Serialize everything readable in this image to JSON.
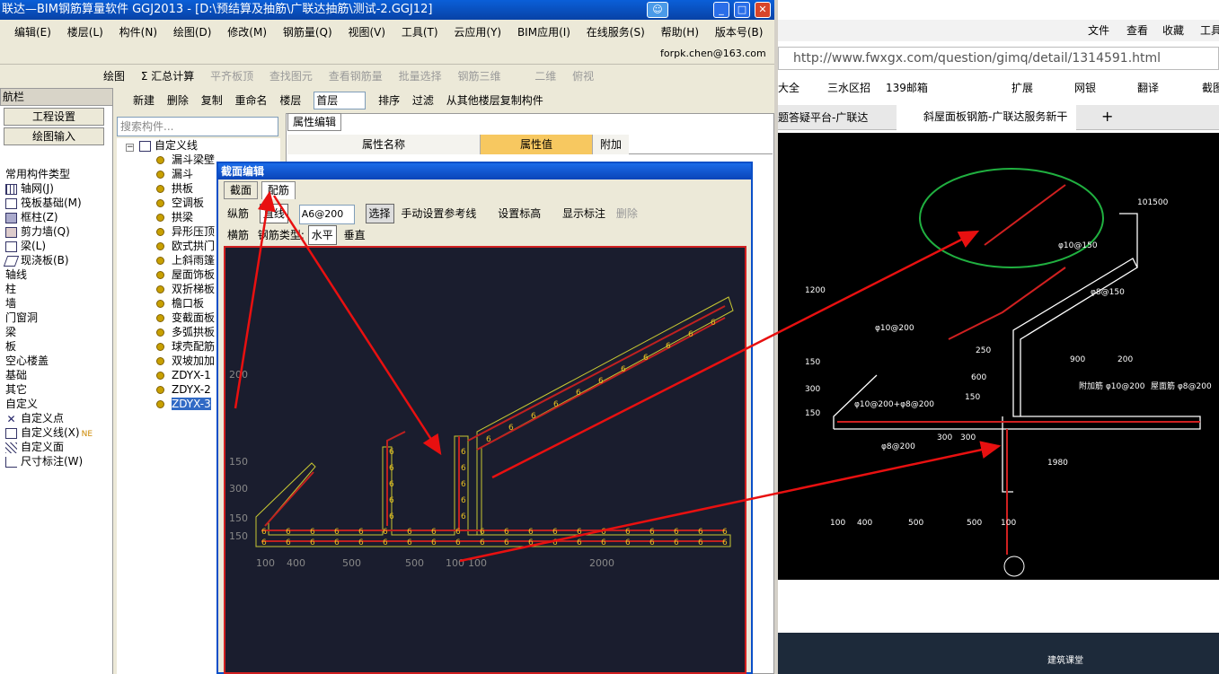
{
  "app": {
    "title": "联达—BIM钢筋算量软件 GGJ2013 - [D:\\预结算及抽筋\\广联达抽筋\\测试-2.GGJ12]",
    "account": "forpk.chen@163.com"
  },
  "menu": [
    "编辑(E)",
    "楼层(L)",
    "构件(N)",
    "绘图(D)",
    "修改(M)",
    "钢筋量(Q)",
    "视图(V)",
    "工具(T)",
    "云应用(Y)",
    "BIM应用(I)",
    "在线服务(S)",
    "帮助(H)",
    "版本号(B)"
  ],
  "toolbar": {
    "draw": "绘图",
    "sum": "Σ 汇总计算",
    "flat": "平齐板顶",
    "find_elem": "查找图元",
    "view_rebar": "查看钢筋量",
    "batch": "批量选择",
    "rebar3d": "钢筋三维",
    "twod": "二维",
    "topview": "俯视"
  },
  "nav": {
    "header": "航栏",
    "btn1": "工程设置",
    "btn2": "绘图输入",
    "items": [
      "常用构件类型",
      "轴网(J)",
      "筏板基础(M)",
      "框柱(Z)",
      "剪力墙(Q)",
      "梁(L)",
      "现浇板(B)",
      "轴线",
      "柱",
      "墙",
      "门窗洞",
      "梁",
      "板",
      "空心楼盖",
      "基础",
      "其它",
      "自定义",
      "自定义点",
      "自定义线(X)",
      "自定义面",
      "尺寸标注(W)"
    ],
    "new_badge": "NE"
  },
  "comp": {
    "new": "新建",
    "delete": "删除",
    "copy": "复制",
    "rename": "重命名",
    "floor_label": "楼层",
    "floor_val": "首层",
    "sort": "排序",
    "filter": "过滤",
    "copy_from": "从其他楼层复制构件",
    "search_placeholder": "搜索构件..."
  },
  "tree": {
    "root": "自定义线",
    "items": [
      "漏斗梁壁",
      "漏斗",
      "拱板",
      "空调板",
      "拱梁",
      "异形压顶",
      "欧式拱门",
      "上斜雨篷",
      "屋面饰板",
      "双折梯板",
      "檐口板",
      "变截面板",
      "多弧拱板",
      "球壳配筋",
      "双坡加加",
      "ZDYX-1",
      "ZDYX-2",
      "ZDYX-3"
    ]
  },
  "props": {
    "tab": "属性编辑",
    "col_name": "属性名称",
    "col_value": "属性值",
    "col_extra": "附加"
  },
  "dialog": {
    "title": "截面编辑",
    "tab1": "截面",
    "tab2": "配筋",
    "row1_label": "纵筋",
    "line_btn": "直线",
    "spec": "A6@200",
    "select": "选择",
    "manual": "手动设置参考线",
    "set_elev": "设置标高",
    "show_label": "显示标注",
    "delete": "删除",
    "row2_label": "横筋",
    "rebar_type": "钢筋类型:",
    "horizontal": "水平",
    "vertical": "垂直"
  },
  "cad_left": {
    "dims": [
      "100",
      "400",
      "500",
      "500",
      "100",
      "100",
      "2000"
    ],
    "side": [
      "200",
      "150",
      "300",
      "150",
      "150",
      "6"
    ]
  },
  "browser": {
    "file": "文件",
    "view": "查看",
    "fav": "收藏",
    "tools": "工具",
    "url": "http://www.fwxgx.com/question/gimq/detail/1314591.html",
    "bm1": "大全",
    "bm2": "三水区招",
    "bm3": "139邮箱",
    "ext": "扩展",
    "bank": "网银",
    "translate": "翻译",
    "shot": "截图",
    "tab1": "题答疑平台-广联达",
    "tab2": "斜屋面板钢筋-广联达服务新干",
    "banner": "建筑课堂"
  },
  "cad_right": {
    "dims": [
      "100",
      "400",
      "500",
      "500",
      "100",
      "300",
      "300",
      "1980",
      "600",
      "150",
      "250",
      "900",
      "200",
      "1200",
      "150",
      "300",
      "150",
      "101500"
    ],
    "labels": [
      "φ10@150",
      "φ8@200",
      "φ10@200+φ8@200",
      "附加筋 φ10@200",
      "屋面筋 φ8@200",
      "φ10@200",
      "φ8@150"
    ]
  }
}
